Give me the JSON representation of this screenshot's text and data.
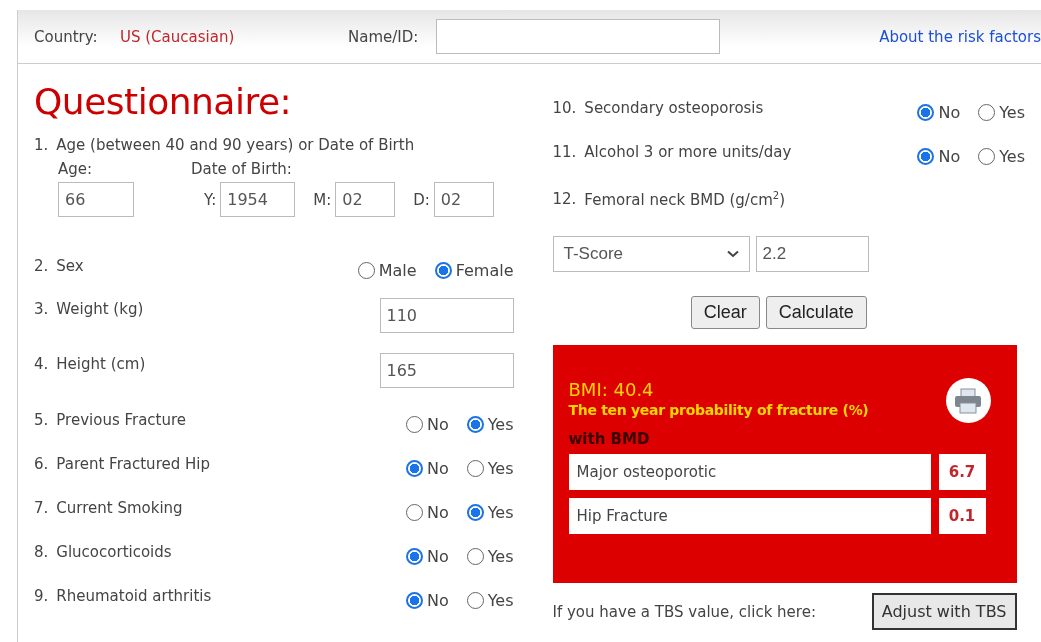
{
  "header": {
    "country_label": "Country:",
    "country": "US (Caucasian)",
    "name_label": "Name/ID:",
    "about_link": "About the risk factors"
  },
  "questionnaire": {
    "title": "Questionnaire:",
    "left": [
      {
        "kind": "age",
        "number": "1.",
        "label": "Age (between 40 and 90 years) or Date of Birth",
        "age_label": "Age:",
        "age": "66",
        "dob_label": "Date of Birth:",
        "dob": [
          {
            "label": "Y:",
            "value": "1954"
          },
          {
            "label": "M:",
            "value": "02"
          },
          {
            "label": "D:",
            "value": "02"
          }
        ]
      },
      {
        "kind": "radio",
        "number": "2.",
        "label": "Sex",
        "options": [
          {
            "label": "Male",
            "selected": false
          },
          {
            "label": "Female",
            "selected": true
          }
        ]
      },
      {
        "kind": "number",
        "number": "3.",
        "label": "Weight (kg)",
        "value": "110"
      },
      {
        "kind": "number",
        "number": "4.",
        "label": "Height (cm)",
        "value": "165"
      },
      {
        "kind": "radio",
        "number": "5.",
        "label": "Previous Fracture",
        "options": [
          {
            "label": "No",
            "selected": false
          },
          {
            "label": "Yes",
            "selected": true
          }
        ]
      },
      {
        "kind": "radio",
        "number": "6.",
        "label": "Parent Fractured Hip",
        "options": [
          {
            "label": "No",
            "selected": true
          },
          {
            "label": "Yes",
            "selected": false
          }
        ]
      },
      {
        "kind": "radio",
        "number": "7.",
        "label": "Current Smoking",
        "options": [
          {
            "label": "No",
            "selected": false
          },
          {
            "label": "Yes",
            "selected": true
          }
        ]
      },
      {
        "kind": "radio",
        "number": "8.",
        "label": "Glucocorticoids",
        "options": [
          {
            "label": "No",
            "selected": true
          },
          {
            "label": "Yes",
            "selected": false
          }
        ]
      },
      {
        "kind": "radio",
        "number": "9.",
        "label": "Rheumatoid arthritis",
        "options": [
          {
            "label": "No",
            "selected": true
          },
          {
            "label": "Yes",
            "selected": false
          }
        ]
      }
    ],
    "right": [
      {
        "kind": "radio",
        "number": "10.",
        "label": "Secondary osteoporosis",
        "options": [
          {
            "label": "No",
            "selected": true
          },
          {
            "label": "Yes",
            "selected": false
          }
        ]
      },
      {
        "kind": "radio",
        "number": "11.",
        "label": "Alcohol 3 or more units/day",
        "options": [
          {
            "label": "No",
            "selected": true
          },
          {
            "label": "Yes",
            "selected": false
          }
        ]
      },
      {
        "kind": "bmd",
        "number": "12.",
        "label": "Femoral neck BMD (g/cm$^{2}$)",
        "select": "T-Score",
        "value": "2.2"
      }
    ]
  },
  "buttons": [
    "Clear",
    "Calculate"
  ],
  "result": {
    "bmi": "BMI: 40.4",
    "subtitle": "The ten year probability of fracture (%)",
    "section": "with BMD",
    "rows": [
      {
        "label": "Major osteoporotic",
        "value": "6.7"
      },
      {
        "label": "Hip Fracture",
        "value": "0.1"
      }
    ]
  },
  "tbs": {
    "prompt": "If you have a TBS value, click here:",
    "button": "Adjust with TBS"
  }
}
